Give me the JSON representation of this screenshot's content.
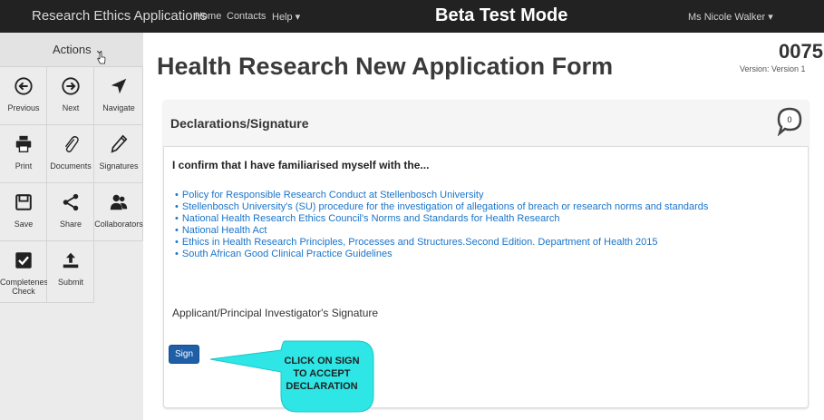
{
  "navbar": {
    "brand": "Research Ethics Applications",
    "links": [
      "Home",
      "Contacts",
      "Help ▾"
    ],
    "beta": "Beta Test Mode",
    "user": "Ms Nicole Walker ▾"
  },
  "sidebar": {
    "actions_label": "Actions ⌄",
    "items": [
      {
        "label": "Previous",
        "icon": "arrow-left-circle-icon"
      },
      {
        "label": "Next",
        "icon": "arrow-right-circle-icon"
      },
      {
        "label": "Navigate",
        "icon": "location-arrow-icon"
      },
      {
        "label": "Print",
        "icon": "printer-icon"
      },
      {
        "label": "Documents",
        "icon": "paperclip-icon"
      },
      {
        "label": "Signatures",
        "icon": "pen-icon"
      },
      {
        "label": "Save",
        "icon": "save-disk-icon"
      },
      {
        "label": "Share",
        "icon": "share-icon"
      },
      {
        "label": "Collaborators",
        "icon": "users-icon"
      },
      {
        "label": "Completeness Check",
        "icon": "checkbox-icon"
      },
      {
        "label": "Submit",
        "icon": "upload-icon"
      }
    ]
  },
  "main": {
    "title": "Health Research New Application Form",
    "app_number": "0075",
    "version": "Version: Version 1"
  },
  "panel": {
    "title": "Declarations/Signature",
    "comment_count": "0",
    "confirm_text": "I confirm that I have familiarised myself with the...",
    "links": [
      "Policy for Responsible Research Conduct at Stellenbosch University",
      "Stellenbosch University's (SU) procedure for the investigation of allegations of breach or research norms and standards",
      "National Health Research Ethics Council's Norms and Standards for Health Research",
      "National Health Act",
      "Ethics in Health Research Principles, Processes and Structures.Second Edition. Department of Health 2015",
      "South African Good Clinical Practice Guidelines"
    ],
    "signature_label": "Applicant/Principal Investigator's Signature",
    "sign_button": "Sign"
  },
  "callout": {
    "text": "CLICK ON SIGN TO ACCEPT DECLARATION",
    "color": "#2ee6e6"
  }
}
